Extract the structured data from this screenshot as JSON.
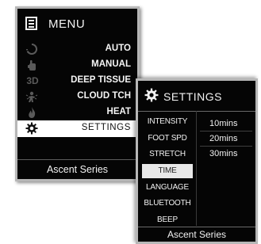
{
  "menu": {
    "title": "MENU",
    "icon": "menu-list-icon",
    "items": [
      {
        "label": "AUTO",
        "icon": "auto-cycle-icon",
        "icon_text": ""
      },
      {
        "label": "MANUAL",
        "icon": "hand-icon",
        "icon_text": ""
      },
      {
        "label": "DEEP TISSUE",
        "icon": "3d-icon",
        "icon_text": "3D"
      },
      {
        "label": "CLOUD TCH",
        "icon": "cloud-touch-icon",
        "icon_text": ""
      },
      {
        "label": "HEAT",
        "icon": "flame-icon",
        "icon_text": ""
      },
      {
        "label": "SETTINGS",
        "icon": "gear-icon",
        "icon_text": "",
        "selected": true
      }
    ],
    "footer": "Ascent Series"
  },
  "settings": {
    "title": "SETTINGS",
    "icon": "gear-icon",
    "items": [
      {
        "label": "INTENSITY"
      },
      {
        "label": "FOOT SPD"
      },
      {
        "label": "STRETCH"
      },
      {
        "label": "TIME",
        "selected": true
      },
      {
        "label": "LANGUAGE"
      },
      {
        "label": "BLUETOOTH"
      },
      {
        "label": "BEEP"
      }
    ],
    "time_options": [
      "10mins",
      "20mins",
      "30mins"
    ],
    "footer": "Ascent Series"
  },
  "colors": {
    "screen_bg": "#050505",
    "text": "#f2f2f2",
    "selected_bg": "#ffffff",
    "bezel": "#b7b7b7"
  }
}
